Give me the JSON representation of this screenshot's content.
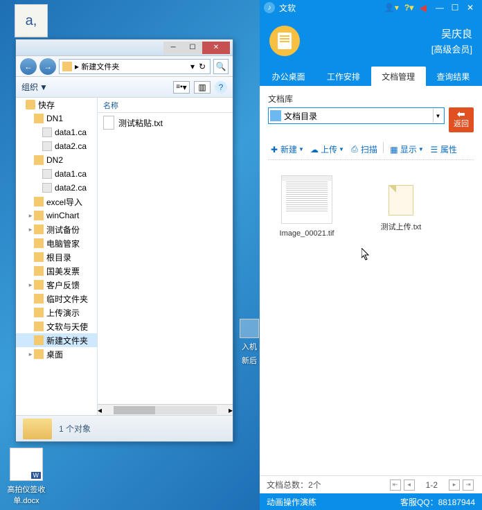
{
  "desktop": {
    "word_icon_letter": "a,",
    "docx_label": "高拍仪签收单.docx",
    "docx_badge": "W",
    "blur1": "入机",
    "blur2": "新后"
  },
  "explorer": {
    "nav_back": "←",
    "nav_fwd": "→",
    "path_text": "新建文件夹",
    "path_sep": "▸",
    "addr_drop": "▾",
    "refresh": "↻",
    "search": "🔍",
    "toolbar": {
      "organize": "组织",
      "drop": "▼",
      "view_drop": "▾",
      "preview": "▥",
      "help": "?"
    },
    "tree": [
      {
        "indent": 0,
        "icon": "fav",
        "label": "快存",
        "exp": ""
      },
      {
        "indent": 1,
        "icon": "folder",
        "label": "DN1",
        "exp": ""
      },
      {
        "indent": 2,
        "icon": "file",
        "label": "data1.ca",
        "exp": ""
      },
      {
        "indent": 2,
        "icon": "file",
        "label": "data2.ca",
        "exp": ""
      },
      {
        "indent": 1,
        "icon": "folder",
        "label": "DN2",
        "exp": ""
      },
      {
        "indent": 2,
        "icon": "file",
        "label": "data1.ca",
        "exp": ""
      },
      {
        "indent": 2,
        "icon": "file",
        "label": "data2.ca",
        "exp": ""
      },
      {
        "indent": 1,
        "icon": "folder",
        "label": "excel导入",
        "exp": ""
      },
      {
        "indent": 1,
        "icon": "folder",
        "label": "winChart",
        "exp": "▸"
      },
      {
        "indent": 1,
        "icon": "folder",
        "label": "测试备份",
        "exp": "▸"
      },
      {
        "indent": 1,
        "icon": "folder",
        "label": "电脑管家",
        "exp": ""
      },
      {
        "indent": 1,
        "icon": "folder",
        "label": "根目录",
        "exp": ""
      },
      {
        "indent": 1,
        "icon": "folder",
        "label": "国美发票",
        "exp": ""
      },
      {
        "indent": 1,
        "icon": "folder",
        "label": "客户反馈",
        "exp": "▸"
      },
      {
        "indent": 1,
        "icon": "folder",
        "label": "临时文件夹",
        "exp": ""
      },
      {
        "indent": 1,
        "icon": "folder",
        "label": "上传演示",
        "exp": ""
      },
      {
        "indent": 1,
        "icon": "folder",
        "label": "文软与天使",
        "exp": ""
      },
      {
        "indent": 1,
        "icon": "folder",
        "label": "新建文件夹",
        "exp": "",
        "selected": true
      },
      {
        "indent": 1,
        "icon": "folder",
        "label": "桌面",
        "exp": "▸"
      }
    ],
    "content_header": "名称",
    "content_file": "测试粘贴.txt",
    "hscroll_left": "◂",
    "hscroll_right": "▸",
    "status": "1 个对象"
  },
  "app": {
    "title": "文软",
    "logo": "♪",
    "tb_min": "—",
    "tb_max": "☐",
    "tb_close": "✕",
    "user_name": "吴庆良",
    "user_level": "[高级会员]",
    "tabs": [
      "办公桌面",
      "工作安排",
      "文档管理",
      "查询结果"
    ],
    "active_tab": 2,
    "doc_lib_label": "文档库",
    "doc_combo_text": "文档目录",
    "doc_combo_drop": "▼",
    "return_btn": "返回",
    "toolbar": {
      "new": "新建",
      "upload": "上传",
      "scan": "扫描",
      "view": "显示",
      "props": "属性",
      "drop": "▼"
    },
    "files": [
      {
        "name": "Image_00021.tif",
        "type": "doc"
      },
      {
        "name": "测试上传.txt",
        "type": "txt"
      }
    ],
    "pager": {
      "total": "文档总数：2个",
      "first": "⇤",
      "prev": "◂",
      "range": "1-2",
      "next": "▸",
      "last": "⇥"
    },
    "footer_left": "动画操作演练",
    "footer_right": "客服QQ：88187944"
  }
}
